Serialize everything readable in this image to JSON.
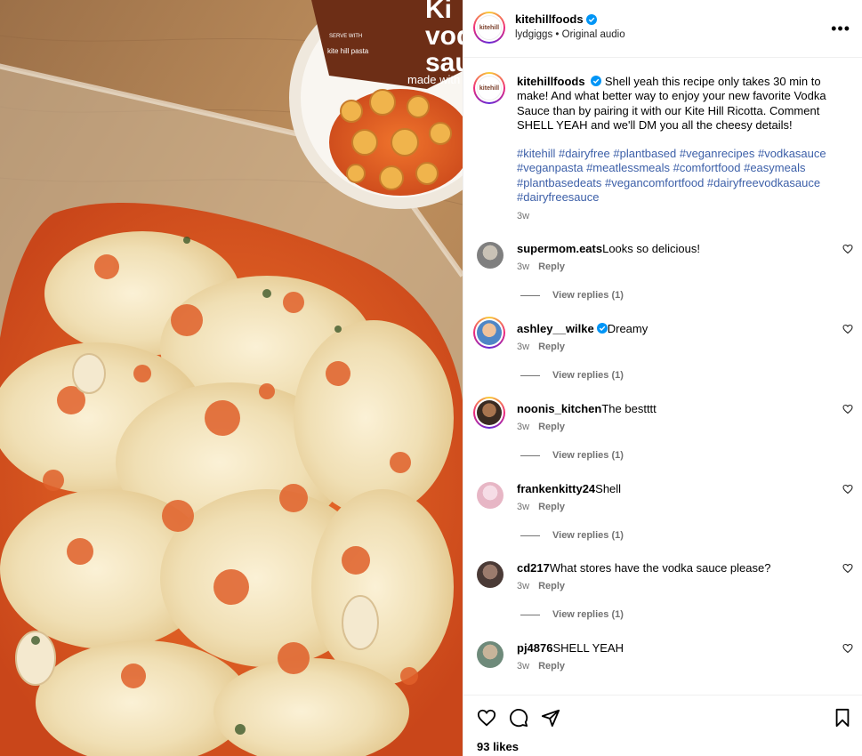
{
  "post": {
    "author": "kitehillfoods",
    "audio_user": "lydgiggs",
    "audio_label": "Original audio",
    "avatar_text": "kitehill",
    "caption": "Shell yeah this recipe only takes 30 min to make! And what better way to enjoy your new favorite Vodka Sauce than by pairing it with our Kite Hill Ricotta. Comment SHELL YEAH and we'll DM you all the cheesy details!",
    "hashtags": "#kitehill #dairyfree #plantbased #veganrecipes #vodkasauce #veganpasta #meatlessmeals #comfortfood #easymeals #plantbasedeats #vegancomfortfood #dairyfreevodkasauce #dairyfreesauce",
    "time": "3w",
    "likes": "93 likes",
    "more_icon": "more-horizontal-icon"
  },
  "media": {
    "jar_text_1": "Ki",
    "jar_text_2": "vod",
    "jar_text_3": "sau",
    "jar_text_4": "made with",
    "jar_small": "SERVE WITH",
    "jar_small_2": "kite hill pasta"
  },
  "comments": [
    {
      "user": "supermom.eats",
      "text": "Looks so delicious!",
      "time": "3w",
      "reply": "Reply",
      "view_replies": "View replies (1)",
      "verified": false
    },
    {
      "user": "ashley__wilke",
      "text": "Dreamy",
      "time": "3w",
      "reply": "Reply",
      "view_replies": "View replies (1)",
      "verified": true
    },
    {
      "user": "noonis_kitchen",
      "text": "The bestttt",
      "time": "3w",
      "reply": "Reply",
      "view_replies": "View replies (1)",
      "verified": false
    },
    {
      "user": "frankenkitty24",
      "text": "Shell",
      "time": "3w",
      "reply": "Reply",
      "view_replies": "View replies (1)",
      "verified": false
    },
    {
      "user": "cd217",
      "text": "What stores have the vodka sauce please?",
      "time": "3w",
      "reply": "Reply",
      "view_replies": "View replies (1)",
      "verified": false
    },
    {
      "user": "pj4876",
      "text": "SHELL YEAH",
      "time": "3w",
      "reply": "Reply",
      "view_replies": "",
      "verified": false
    }
  ],
  "colors": {
    "link": "#3c5fa8",
    "verified": "#0095f6",
    "muted": "#737373"
  }
}
